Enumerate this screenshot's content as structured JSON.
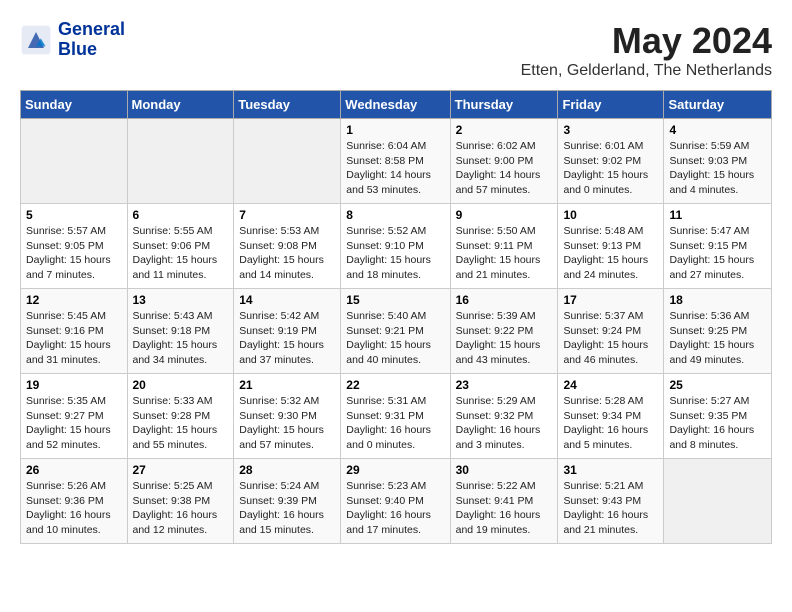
{
  "header": {
    "logo_line1": "General",
    "logo_line2": "Blue",
    "month": "May 2024",
    "location": "Etten, Gelderland, The Netherlands"
  },
  "columns": [
    "Sunday",
    "Monday",
    "Tuesday",
    "Wednesday",
    "Thursday",
    "Friday",
    "Saturday"
  ],
  "rows": [
    [
      {
        "day": "",
        "empty": true
      },
      {
        "day": "",
        "empty": true
      },
      {
        "day": "",
        "empty": true
      },
      {
        "day": "1",
        "sunrise": "6:04 AM",
        "sunset": "8:58 PM",
        "daylight": "14 hours and 53 minutes."
      },
      {
        "day": "2",
        "sunrise": "6:02 AM",
        "sunset": "9:00 PM",
        "daylight": "14 hours and 57 minutes."
      },
      {
        "day": "3",
        "sunrise": "6:01 AM",
        "sunset": "9:02 PM",
        "daylight": "15 hours and 0 minutes."
      },
      {
        "day": "4",
        "sunrise": "5:59 AM",
        "sunset": "9:03 PM",
        "daylight": "15 hours and 4 minutes."
      }
    ],
    [
      {
        "day": "5",
        "sunrise": "5:57 AM",
        "sunset": "9:05 PM",
        "daylight": "15 hours and 7 minutes."
      },
      {
        "day": "6",
        "sunrise": "5:55 AM",
        "sunset": "9:06 PM",
        "daylight": "15 hours and 11 minutes."
      },
      {
        "day": "7",
        "sunrise": "5:53 AM",
        "sunset": "9:08 PM",
        "daylight": "15 hours and 14 minutes."
      },
      {
        "day": "8",
        "sunrise": "5:52 AM",
        "sunset": "9:10 PM",
        "daylight": "15 hours and 18 minutes."
      },
      {
        "day": "9",
        "sunrise": "5:50 AM",
        "sunset": "9:11 PM",
        "daylight": "15 hours and 21 minutes."
      },
      {
        "day": "10",
        "sunrise": "5:48 AM",
        "sunset": "9:13 PM",
        "daylight": "15 hours and 24 minutes."
      },
      {
        "day": "11",
        "sunrise": "5:47 AM",
        "sunset": "9:15 PM",
        "daylight": "15 hours and 27 minutes."
      }
    ],
    [
      {
        "day": "12",
        "sunrise": "5:45 AM",
        "sunset": "9:16 PM",
        "daylight": "15 hours and 31 minutes."
      },
      {
        "day": "13",
        "sunrise": "5:43 AM",
        "sunset": "9:18 PM",
        "daylight": "15 hours and 34 minutes."
      },
      {
        "day": "14",
        "sunrise": "5:42 AM",
        "sunset": "9:19 PM",
        "daylight": "15 hours and 37 minutes."
      },
      {
        "day": "15",
        "sunrise": "5:40 AM",
        "sunset": "9:21 PM",
        "daylight": "15 hours and 40 minutes."
      },
      {
        "day": "16",
        "sunrise": "5:39 AM",
        "sunset": "9:22 PM",
        "daylight": "15 hours and 43 minutes."
      },
      {
        "day": "17",
        "sunrise": "5:37 AM",
        "sunset": "9:24 PM",
        "daylight": "15 hours and 46 minutes."
      },
      {
        "day": "18",
        "sunrise": "5:36 AM",
        "sunset": "9:25 PM",
        "daylight": "15 hours and 49 minutes."
      }
    ],
    [
      {
        "day": "19",
        "sunrise": "5:35 AM",
        "sunset": "9:27 PM",
        "daylight": "15 hours and 52 minutes."
      },
      {
        "day": "20",
        "sunrise": "5:33 AM",
        "sunset": "9:28 PM",
        "daylight": "15 hours and 55 minutes."
      },
      {
        "day": "21",
        "sunrise": "5:32 AM",
        "sunset": "9:30 PM",
        "daylight": "15 hours and 57 minutes."
      },
      {
        "day": "22",
        "sunrise": "5:31 AM",
        "sunset": "9:31 PM",
        "daylight": "16 hours and 0 minutes."
      },
      {
        "day": "23",
        "sunrise": "5:29 AM",
        "sunset": "9:32 PM",
        "daylight": "16 hours and 3 minutes."
      },
      {
        "day": "24",
        "sunrise": "5:28 AM",
        "sunset": "9:34 PM",
        "daylight": "16 hours and 5 minutes."
      },
      {
        "day": "25",
        "sunrise": "5:27 AM",
        "sunset": "9:35 PM",
        "daylight": "16 hours and 8 minutes."
      }
    ],
    [
      {
        "day": "26",
        "sunrise": "5:26 AM",
        "sunset": "9:36 PM",
        "daylight": "16 hours and 10 minutes."
      },
      {
        "day": "27",
        "sunrise": "5:25 AM",
        "sunset": "9:38 PM",
        "daylight": "16 hours and 12 minutes."
      },
      {
        "day": "28",
        "sunrise": "5:24 AM",
        "sunset": "9:39 PM",
        "daylight": "16 hours and 15 minutes."
      },
      {
        "day": "29",
        "sunrise": "5:23 AM",
        "sunset": "9:40 PM",
        "daylight": "16 hours and 17 minutes."
      },
      {
        "day": "30",
        "sunrise": "5:22 AM",
        "sunset": "9:41 PM",
        "daylight": "16 hours and 19 minutes."
      },
      {
        "day": "31",
        "sunrise": "5:21 AM",
        "sunset": "9:43 PM",
        "daylight": "16 hours and 21 minutes."
      },
      {
        "day": "",
        "empty": true
      }
    ]
  ]
}
